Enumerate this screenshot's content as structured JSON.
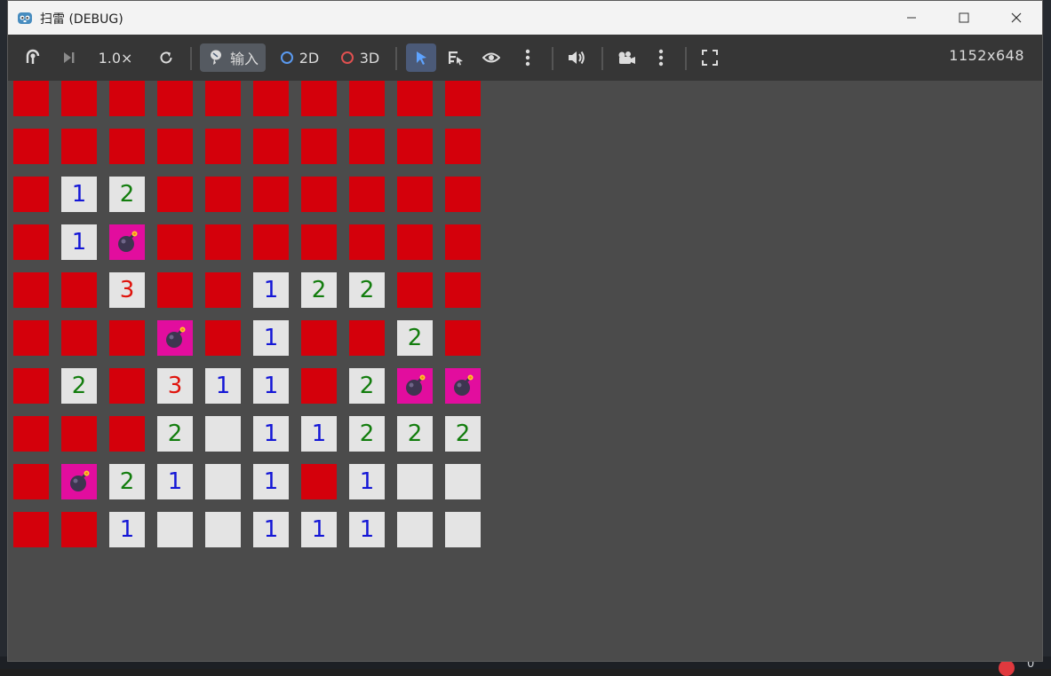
{
  "window": {
    "title": "扫雷 (DEBUG)"
  },
  "toolbar": {
    "speed_label": "1.0×",
    "input_label": "输入",
    "mode_2d_label": "2D",
    "mode_3d_label": "3D",
    "resolution_label": "1152x648",
    "icons": [
      "remote-debug-icon",
      "step-frame-icon",
      "reset-speed-icon",
      "input-icon",
      "select-arrow-icon",
      "list-select-icon",
      "visibility-icon",
      "more-vert-icon",
      "audio-icon",
      "camera-icon",
      "more-vert-icon",
      "fullscreen-icon"
    ],
    "colors": {
      "mode_2d_ring": "#5a9af0",
      "mode_3d_ring": "#e05050"
    }
  },
  "board": {
    "rows": 10,
    "cols": 10,
    "legend": {
      "H": "hidden",
      "M": "mine",
      "0": "empty",
      "1-8": "number"
    },
    "cells": [
      [
        "H",
        "H",
        "H",
        "H",
        "H",
        "H",
        "H",
        "H",
        "H",
        "H"
      ],
      [
        "H",
        "H",
        "H",
        "H",
        "H",
        "H",
        "H",
        "H",
        "H",
        "H"
      ],
      [
        "H",
        "1",
        "2",
        "H",
        "H",
        "H",
        "H",
        "H",
        "H",
        "H"
      ],
      [
        "H",
        "1",
        "M",
        "H",
        "H",
        "H",
        "H",
        "H",
        "H",
        "H"
      ],
      [
        "H",
        "H",
        "3",
        "H",
        "H",
        "1",
        "2",
        "2",
        "H",
        "H"
      ],
      [
        "H",
        "H",
        "H",
        "M",
        "H",
        "1",
        "H",
        "H",
        "2",
        "H"
      ],
      [
        "H",
        "2",
        "H",
        "3",
        "1",
        "1",
        "H",
        "2",
        "M",
        "M"
      ],
      [
        "H",
        "H",
        "H",
        "2",
        "0",
        "1",
        "1",
        "2",
        "2",
        "2"
      ],
      [
        "H",
        "M",
        "2",
        "1",
        "0",
        "1",
        "H",
        "1",
        "0",
        "0"
      ],
      [
        "H",
        "H",
        "1",
        "0",
        "0",
        "1",
        "1",
        "1",
        "0",
        "0"
      ]
    ],
    "colors": {
      "hidden": "#d4000b",
      "open": "#e4e4e4",
      "mine": "#e20d9e",
      "n1": "#1417d6",
      "n2": "#137d0e",
      "n3": "#e0130c"
    }
  },
  "status": {
    "error_count": "0"
  }
}
